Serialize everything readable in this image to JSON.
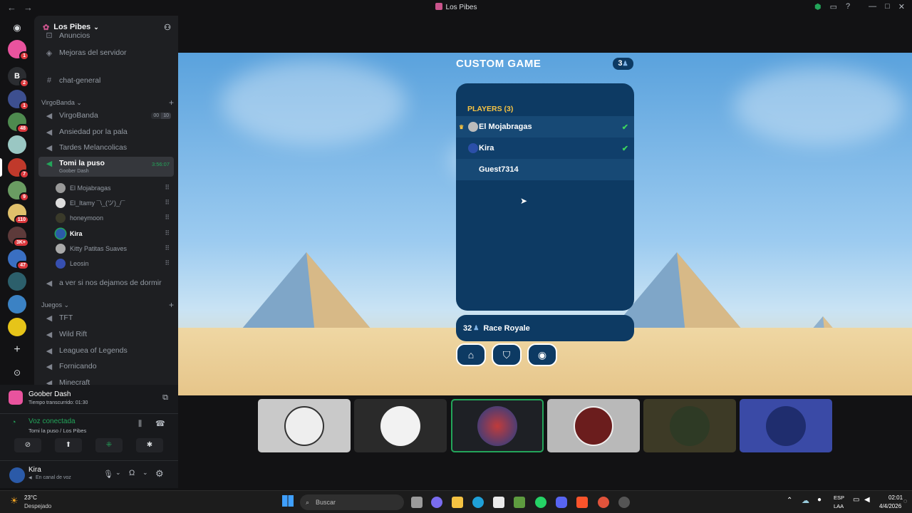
{
  "window": {
    "title": "Los Pibes"
  },
  "server": {
    "name": "Los Pibes"
  },
  "rail": {
    "badges": [
      "1",
      "2",
      "1",
      "48",
      "7",
      "9",
      "110",
      "3K+",
      "47"
    ]
  },
  "channels": {
    "partial": "Anuncios",
    "boost": "Mejoras del servidor",
    "general": "chat-general",
    "cat1": "VirgoBanda",
    "virgobanda": "VirgoBanda",
    "virgo_count_a": "00",
    "virgo_count_b": "10",
    "ansiedad": "Ansiedad por la pala",
    "tardes": "Tardes Melancolicas",
    "tomi": "Tomi la puso",
    "tomi_time": "3:56:07",
    "tomi_activity": "Goober Dash",
    "users": [
      "El Mojabragas",
      "El_Itamy ¯\\_(ツ)_/¯",
      "honeymoon",
      "Kira",
      "Kitty Patitas Suaves",
      "Leosin"
    ],
    "aver": "a ver si nos dejamos de dormir",
    "cat2": "Juegos",
    "tft": "TFT",
    "wildrift": "Wild Rift",
    "lol": "Leaguea of Legends",
    "fornicando": "Fornicando",
    "minecraft": "Minecraft"
  },
  "activity": {
    "game": "Goober Dash",
    "elapsed": "Tiempo transcurrido: 01:30"
  },
  "voice": {
    "status": "Voz conectada",
    "where": "Tomi la puso / Los Pibes"
  },
  "me": {
    "name": "Kira",
    "status": "En canal de voz"
  },
  "game": {
    "title": "CUSTOM GAME",
    "count": "3",
    "players_header": "PLAYERS (3)",
    "players": [
      "El Mojabragas",
      "Kira",
      "Guest7314"
    ],
    "mode_count": "32",
    "mode_name": "Race Royale"
  },
  "taskbar": {
    "temp": "23°C",
    "weather": "Despejado",
    "search": "Buscar",
    "lang1": "ESP",
    "lang2": "LAA",
    "time": "02:01",
    "date": "4/4/2026"
  },
  "colors": {
    "discord_bg": "#1e1f22",
    "green": "#23a55a",
    "game_panel": "#0d3a63",
    "accent_yellow": "#f6c343"
  }
}
